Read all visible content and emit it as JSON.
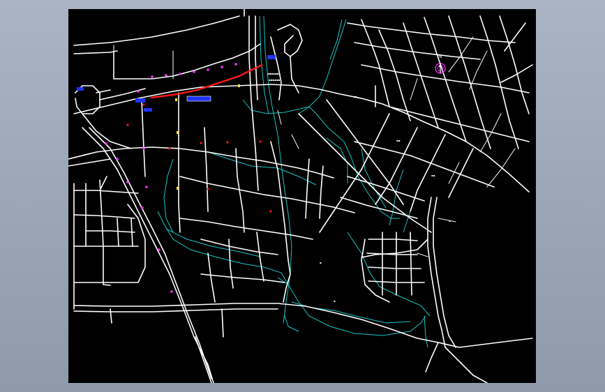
{
  "app": {
    "title": ""
  },
  "map": {
    "compass_label": "N",
    "colors": {
      "background": "#000000",
      "road": "#ffffff",
      "river": "#19c6c6",
      "planned_route": "#ff1a1a",
      "station_marker": "#ff33ff",
      "legend_box": "#2233ff",
      "compass": "#ff33ff"
    },
    "icons": [
      "compass-icon",
      "station-marker-icon",
      "route-line"
    ]
  }
}
